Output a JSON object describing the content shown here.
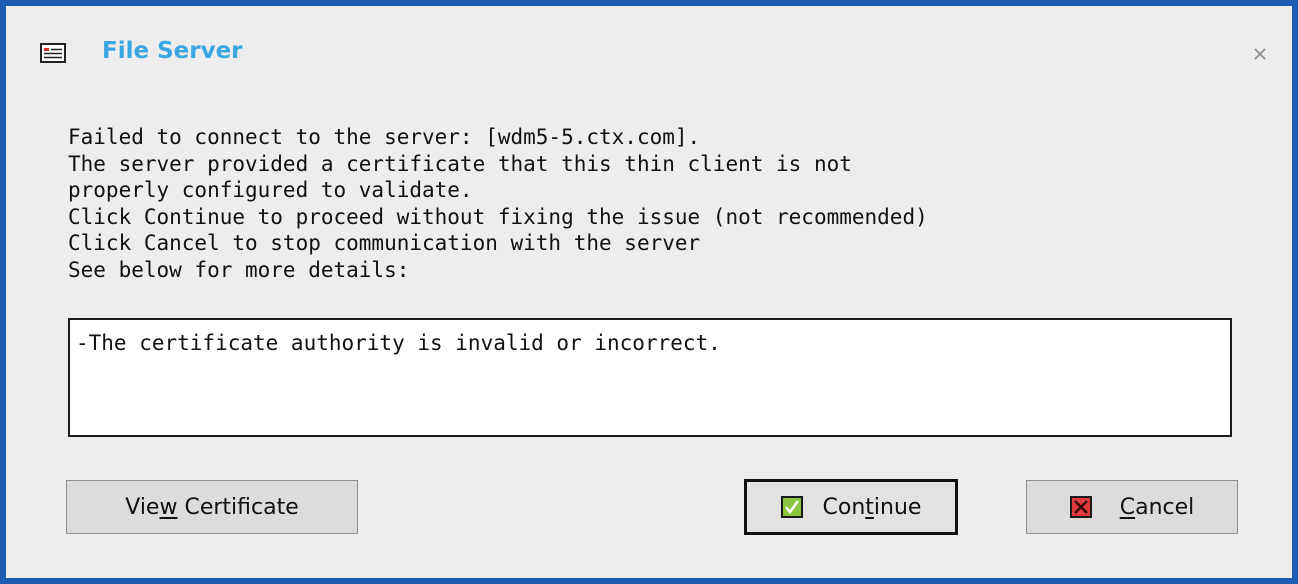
{
  "window": {
    "title": "File Server"
  },
  "message": {
    "lines": [
      "Failed to connect to the server: [wdm5-5.ctx.com].",
      "The server provided a certificate that this thin client is not",
      "properly configured to validate.",
      "Click Continue to proceed without fixing the issue (not recommended)",
      "Click Cancel to stop communication with the server",
      "See below for more details:"
    ]
  },
  "details": {
    "text": "-The certificate authority is invalid or incorrect."
  },
  "buttons": {
    "view_certificate": {
      "pre": "Vie",
      "mnemonic": "w",
      "post": " Certificate"
    },
    "continue": {
      "pre": "Con",
      "mnemonic": "t",
      "post": "inue"
    },
    "cancel": {
      "pre": "",
      "mnemonic": "C",
      "post": "ancel"
    }
  },
  "icons": {
    "title": "window-app-icon",
    "close": "close-icon",
    "continue": "checkmark-icon",
    "cancel": "x-icon"
  },
  "colors": {
    "border": "#1f5bb0",
    "title": "#3aa6e2",
    "background": "#ededed",
    "continue_icon": "#8cc63f",
    "cancel_icon": "#e23a3a"
  }
}
